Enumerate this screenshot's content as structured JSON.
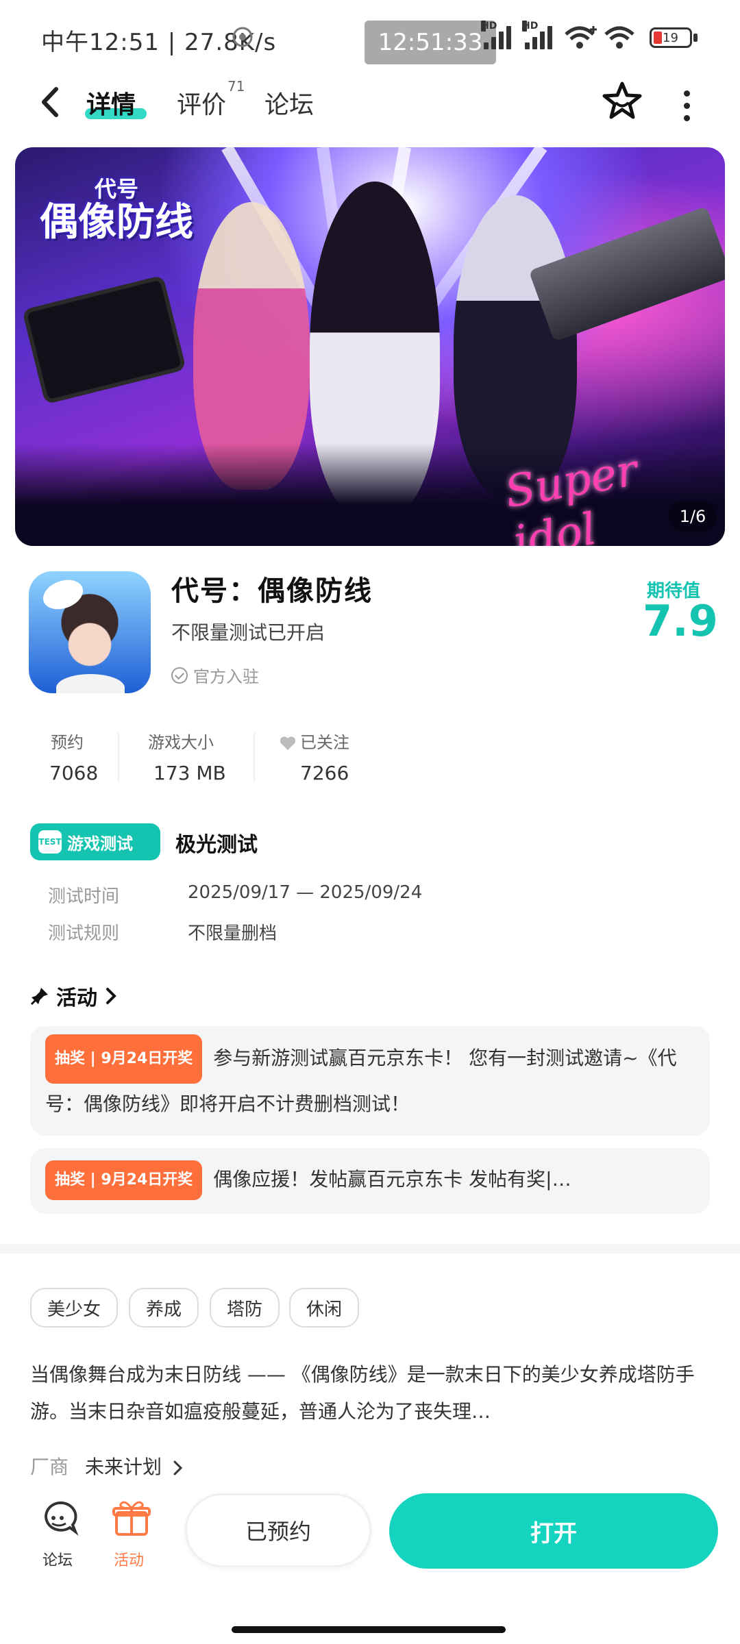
{
  "status_bar": {
    "left_text": "中午12:51 | 27.8K/s",
    "clock": "12:51:33",
    "battery_level": "19",
    "battery_color": "#e53935"
  },
  "nav": {
    "tabs": [
      {
        "label": "详情",
        "active": true
      },
      {
        "label": "评价",
        "badge": "71"
      },
      {
        "label": "论坛"
      }
    ],
    "back_icon": "chevron-left-icon",
    "favorite_icon": "star-icon",
    "more_icon": "more-vertical-icon"
  },
  "banner": {
    "title_small": "代号",
    "title": "偶像防线",
    "overlay_text": "Super idol",
    "counter": "1/6"
  },
  "app": {
    "name": "代号：偶像防线",
    "subtitle": "不限量测试已开启",
    "official_label": "官方入驻",
    "expect_label": "期待值",
    "expect_value": "7.9",
    "accent": "#14c4b0"
  },
  "stats": [
    {
      "label": "预约",
      "value": "7068"
    },
    {
      "label": "游戏大小",
      "value": "173 MB"
    },
    {
      "label": "已关注",
      "value": "7266"
    }
  ],
  "test": {
    "chip_label": "游戏测试",
    "chip_icon_text": "TEST",
    "name": "极光测试",
    "rows": [
      {
        "label": "测试时间",
        "value": "2025/09/17 — 2025/09/24"
      },
      {
        "label": "测试规则",
        "value": "不限量删档"
      }
    ]
  },
  "activity": {
    "title": "活动",
    "items": [
      {
        "tag": "抽奖 | 9月24日开奖",
        "text": "参与新游测试赢百元京东卡！ 您有一封测试邀请~《代号：偶像防线》即将开启不计费删档测试！"
      },
      {
        "tag": "抽奖 | 9月24日开奖",
        "text": "偶像应援！发帖赢百元京东卡 发帖有奖|…"
      }
    ],
    "tag_color": "#ff6f3c"
  },
  "tags": [
    "美少女",
    "养成",
    "塔防",
    "休闲"
  ],
  "description": "当偶像舞台成为末日防线 —— 《偶像防线》是一款末日下的美少女养成塔防手游。当末日杂音如瘟疫般蔓延，普通人沦为了丧失理…",
  "vendor": {
    "label": "厂商",
    "name": "未来计划"
  },
  "bottom_bar": {
    "forum_label": "论坛",
    "activity_label": "活动",
    "reserved_label": "已预约",
    "open_label": "打开",
    "activity_color": "#ff7a45"
  }
}
